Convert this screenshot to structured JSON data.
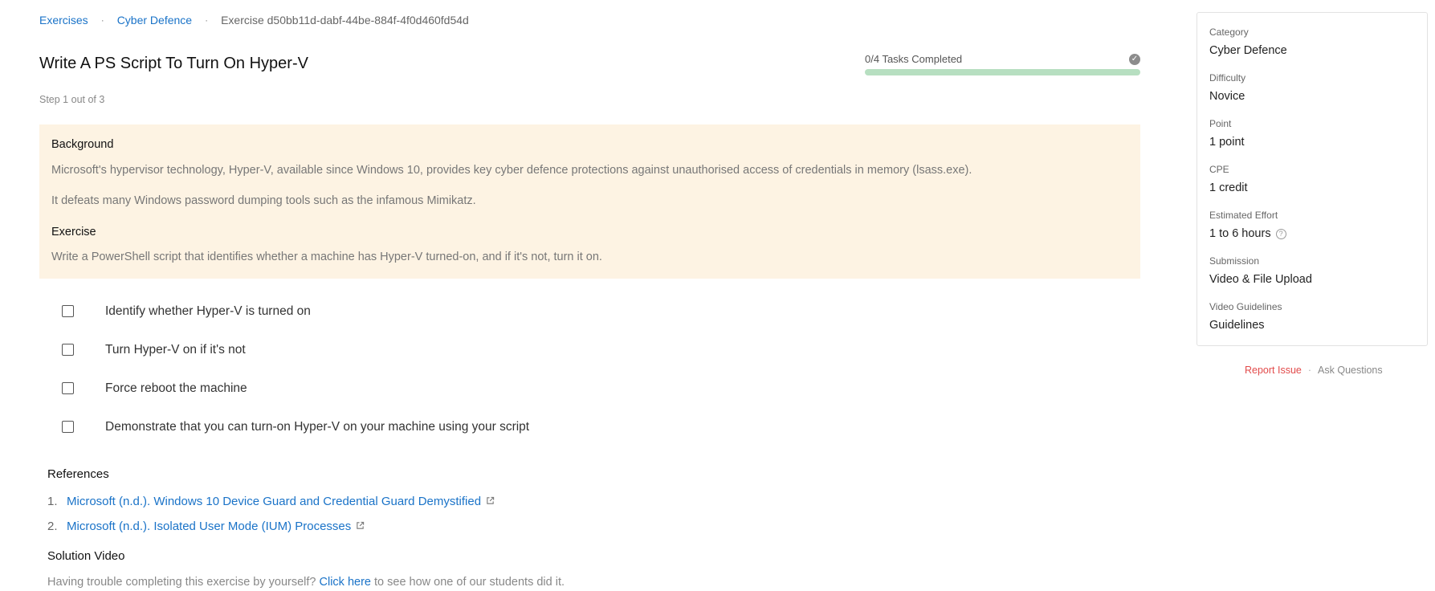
{
  "breadcrumb": {
    "items": [
      "Exercises",
      "Cyber Defence",
      "Exercise d50bb11d-dabf-44be-884f-4f0d460fd54d"
    ],
    "separator": "·"
  },
  "title": "Write A PS Script To Turn On Hyper-V",
  "step": "Step 1 out of 3",
  "progress": {
    "label": "0/4 Tasks Completed",
    "completed": 0,
    "total": 4,
    "check_icon": "check-circle-icon"
  },
  "background": {
    "heading": "Background",
    "p1": "Microsoft's hypervisor technology, Hyper-V, available since Windows 10, provides key cyber defence protections against unauthorised access of credentials in memory (lsass.exe).",
    "p2": "It defeats many Windows password dumping tools such as the infamous Mimikatz.",
    "exercise_heading": "Exercise",
    "p3": "Write a PowerShell script that identifies whether a machine has Hyper-V turned-on, and if it's not, turn it on."
  },
  "tasks": [
    {
      "label": "Identify whether Hyper-V is turned on",
      "checked": false
    },
    {
      "label": "Turn Hyper-V on if it's not",
      "checked": false
    },
    {
      "label": "Force reboot the machine",
      "checked": false
    },
    {
      "label": "Demonstrate that you can turn-on Hyper-V on your machine using your script",
      "checked": false
    }
  ],
  "references": {
    "heading": "References",
    "items": [
      {
        "num": "1.",
        "text": "Microsoft (n.d.). Windows 10 Device Guard and Credential Guard Demystified"
      },
      {
        "num": "2.",
        "text": "Microsoft (n.d.). Isolated User Mode (IUM) Processes"
      }
    ]
  },
  "solution": {
    "heading": "Solution Video",
    "prefix": "Having trouble completing this exercise by yourself?",
    "link": "Click here",
    "suffix": "to see how one of our students did it."
  },
  "sidebar": {
    "category_label": "Category",
    "category": "Cyber Defence",
    "difficulty_label": "Difficulty",
    "difficulty": "Novice",
    "point_label": "Point",
    "point": "1 point",
    "cpe_label": "CPE",
    "cpe": "1 credit",
    "effort_label": "Estimated Effort",
    "effort": "1 to 6 hours",
    "effort_help": "?",
    "submission_label": "Submission",
    "submission": "Video & File Upload",
    "guidelines_label": "Video Guidelines",
    "guidelines": "Guidelines"
  },
  "links": {
    "report": "Report Issue",
    "separator": "·",
    "ask": "Ask Questions"
  },
  "colors": {
    "link": "#1a73c8",
    "background_box": "#fdf3e3",
    "progress_track": "#b7dfc1",
    "report": "#e24b4b"
  }
}
